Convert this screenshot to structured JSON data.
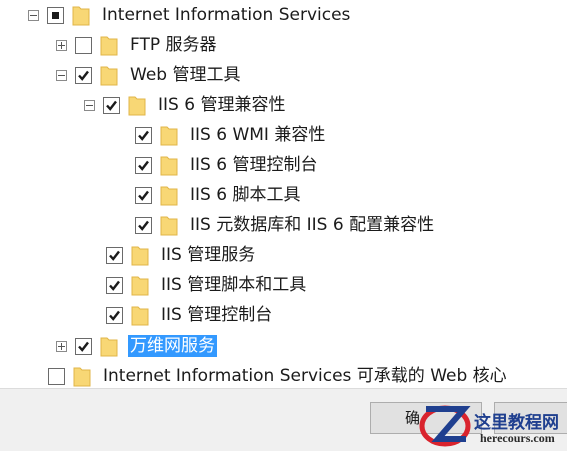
{
  "tree": {
    "items": [
      {
        "label": "Internet Information Services",
        "check": "partial",
        "expander": "minus"
      },
      {
        "label": "FTP 服务器",
        "check": "unchecked",
        "expander": "plus"
      },
      {
        "label": "Web 管理工具",
        "check": "checked",
        "expander": "minus"
      },
      {
        "label": "IIS 6 管理兼容性",
        "check": "checked",
        "expander": "minus"
      },
      {
        "label": "IIS 6 WMI 兼容性",
        "check": "checked",
        "expander": "none"
      },
      {
        "label": "IIS 6 管理控制台",
        "check": "checked",
        "expander": "none"
      },
      {
        "label": "IIS 6 脚本工具",
        "check": "checked",
        "expander": "none"
      },
      {
        "label": "IIS 元数据库和 IIS 6 配置兼容性",
        "check": "checked",
        "expander": "none"
      },
      {
        "label": "IIS 管理服务",
        "check": "checked",
        "expander": "none"
      },
      {
        "label": "IIS 管理脚本和工具",
        "check": "checked",
        "expander": "none"
      },
      {
        "label": "IIS 管理控制台",
        "check": "checked",
        "expander": "none"
      },
      {
        "label": "万维网服务",
        "check": "checked",
        "expander": "plus",
        "selected": true
      },
      {
        "label": "Internet Information Services 可承载的 Web 核心",
        "check": "unchecked",
        "expander": "none"
      }
    ]
  },
  "buttons": {
    "ok_label": "确"
  },
  "watermark": {
    "title": "这里教程网",
    "url": "herecours.com",
    "logo_letter": "Z"
  },
  "colors": {
    "selection": "#3399ff",
    "folder_fill": "#f8d775",
    "folder_edge": "#e0b548",
    "watermark_blue": "#1f3f8f",
    "watermark_red": "#d9232d"
  }
}
